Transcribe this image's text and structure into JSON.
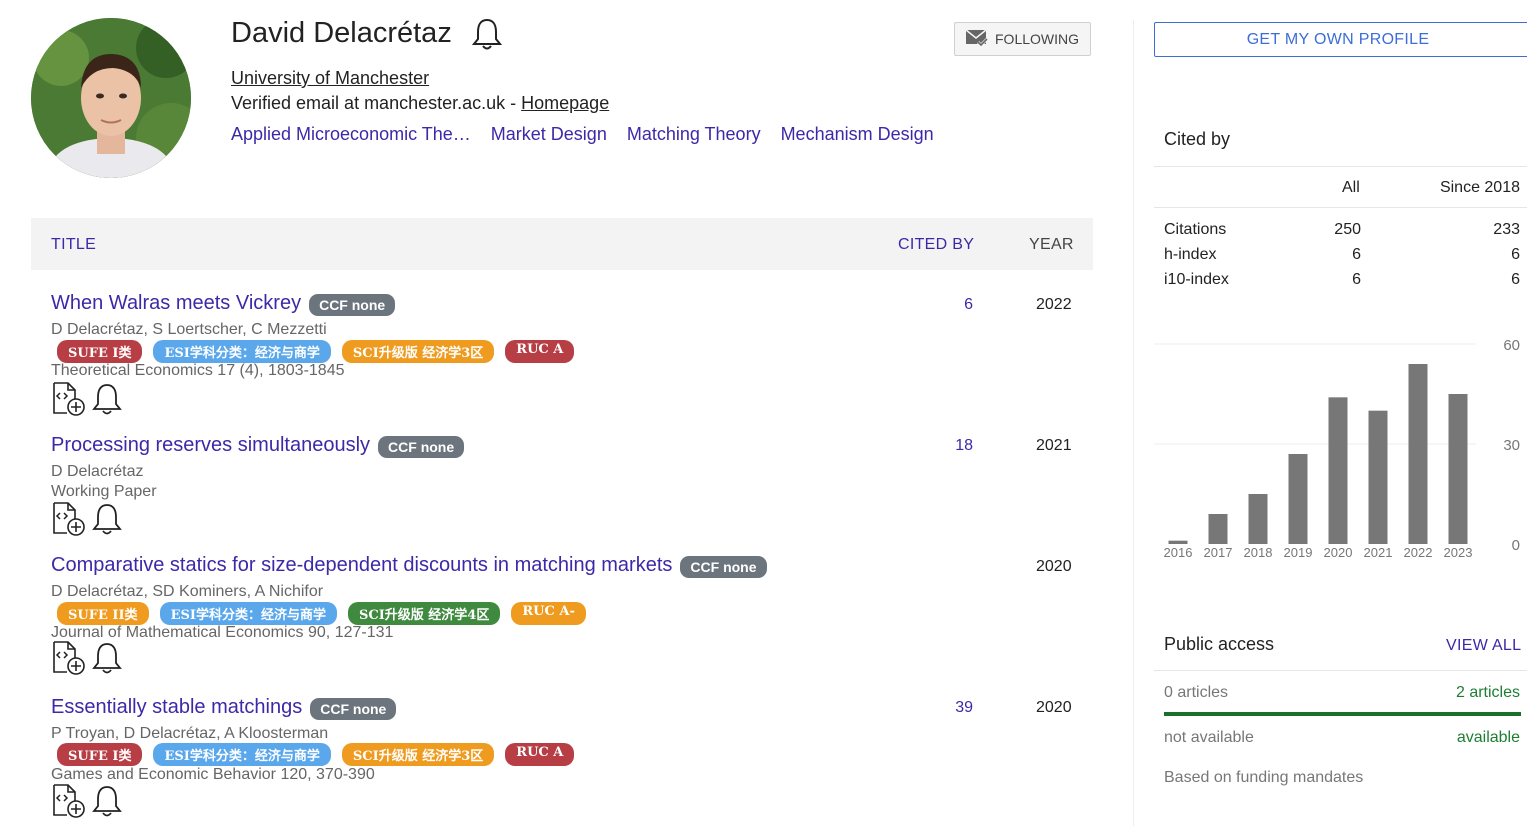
{
  "profile": {
    "name": "David Delacrétaz",
    "affiliation": "University of Manchester",
    "email_text": "Verified email at manchester.ac.uk - ",
    "homepage": "Homepage",
    "interests": [
      "Applied Microeconomic The…",
      "Market Design",
      "Matching Theory",
      "Mechanism Design"
    ],
    "follow_label": "FOLLOWING"
  },
  "table": {
    "title_col": "TITLE",
    "cited_col": "CITED BY",
    "year_col": "YEAR"
  },
  "articles": [
    {
      "title": "When Walras meets Vickrey",
      "ccf": "CCF none",
      "cited": "6",
      "year": "2022",
      "authors": "D Delacrétaz, S Loertscher, C Mezzetti",
      "badges": [
        {
          "text": "SUFE I类",
          "color": "#b73e44"
        },
        {
          "text": "ESI学科分类：经济与商学",
          "color": "#5aa7ec"
        },
        {
          "text": "SCI升级版 经济学3区",
          "color": "#ef9b1f"
        },
        {
          "text": "RUC A",
          "color": "#b73e44"
        }
      ],
      "venue": "Theoretical Economics 17 (4), 1803-1845"
    },
    {
      "title": "Processing reserves simultaneously",
      "ccf": "CCF none",
      "cited": "18",
      "year": "2021",
      "authors": "D Delacrétaz",
      "badges": [],
      "venue": "Working Paper"
    },
    {
      "title": "Comparative statics for size-dependent discounts in matching markets",
      "ccf": "CCF none",
      "cited": "",
      "year": "2020",
      "authors": "D Delacrétaz, SD Kominers, A Nichifor",
      "badges": [
        {
          "text": "SUFE II类",
          "color": "#ef9b1f"
        },
        {
          "text": "ESI学科分类：经济与商学",
          "color": "#5aa7ec"
        },
        {
          "text": "SCI升级版 经济学4区",
          "color": "#3f8a3f"
        },
        {
          "text": "RUC A-",
          "color": "#ef9b1f"
        }
      ],
      "venue": "Journal of Mathematical Economics 90, 127-131"
    },
    {
      "title": "Essentially stable matchings",
      "ccf": "CCF none",
      "cited": "39",
      "year": "2020",
      "authors": "P Troyan, D Delacrétaz, A Kloosterman",
      "badges": [
        {
          "text": "SUFE I类",
          "color": "#b73e44"
        },
        {
          "text": "ESI学科分类：经济与商学",
          "color": "#5aa7ec"
        },
        {
          "text": "SCI升级版 经济学3区",
          "color": "#ef9b1f"
        },
        {
          "text": "RUC A",
          "color": "#b73e44"
        }
      ],
      "venue": "Games and Economic Behavior 120, 370-390"
    }
  ],
  "sidebar": {
    "own_profile_label": "GET MY OWN PROFILE",
    "cited_by_title": "Cited by",
    "col_all": "All",
    "col_since": "Since 2018",
    "stats": [
      {
        "label": "Citations",
        "all": "250",
        "since": "233"
      },
      {
        "label": "h-index",
        "all": "6",
        "since": "6"
      },
      {
        "label": "i10-index",
        "all": "6",
        "since": "6"
      }
    ],
    "public_access_title": "Public access",
    "view_all": "VIEW ALL",
    "left_count": "0 articles",
    "right_count": "2 articles",
    "left_status": "not available",
    "right_status": "available",
    "note": "Based on funding mandates"
  },
  "chart_data": {
    "type": "bar",
    "categories": [
      "2016",
      "2017",
      "2018",
      "2019",
      "2020",
      "2021",
      "2022",
      "2023"
    ],
    "values": [
      1,
      9,
      15,
      27,
      44,
      40,
      54,
      45
    ],
    "ylim": [
      0,
      60
    ],
    "yticks": [
      0,
      30,
      60
    ],
    "bar_color": "#777777",
    "grid": true
  }
}
